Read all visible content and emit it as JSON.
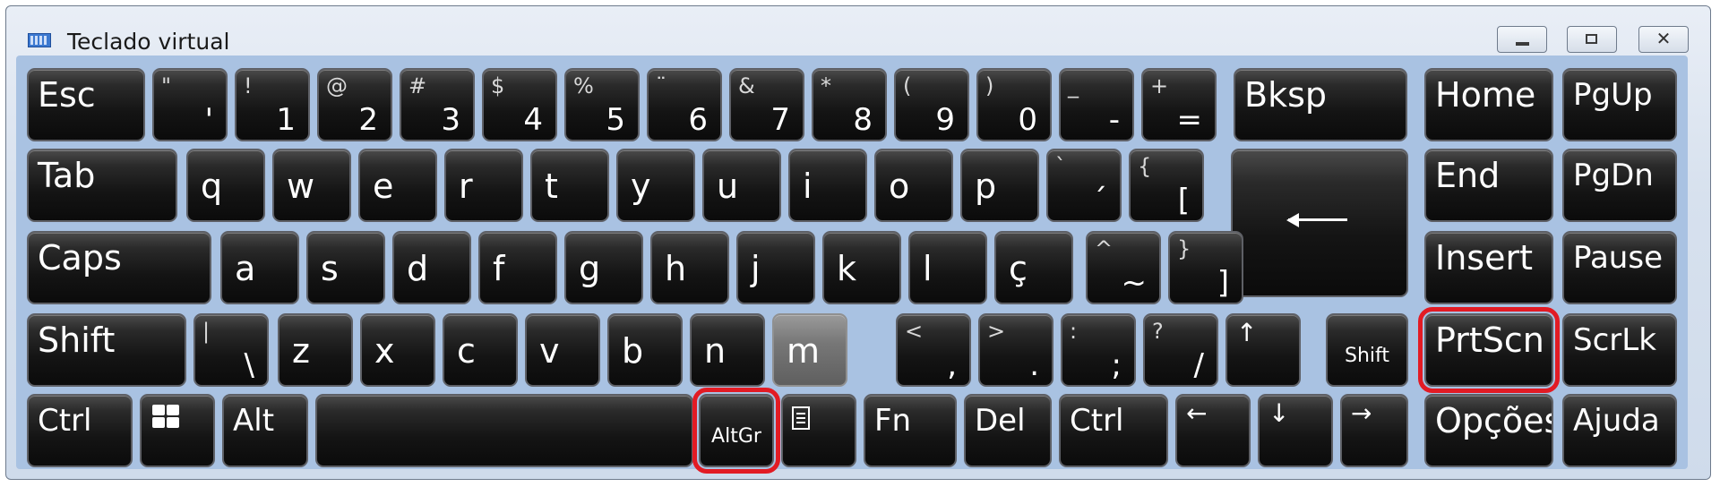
{
  "window": {
    "title": "Teclado virtual"
  },
  "titlebar_buttons": {
    "minimize": "",
    "maximize": "",
    "close": "✕"
  },
  "icons": {
    "app": "keyboard-icon",
    "windows": "windows-logo-icon",
    "menu": "context-menu-icon",
    "enter": "enter-arrow-icon"
  },
  "highlight_color": "#e21b24",
  "keys": {
    "esc": "Esc",
    "bksp": "Bksp",
    "home": "Home",
    "pgup": "PgUp",
    "tab": "Tab",
    "end": "End",
    "pgdn": "PgDn",
    "caps": "Caps",
    "insert": "Insert",
    "pause": "Pause",
    "shift_left": "Shift",
    "shift_right": "Shift",
    "prtscn": "PrtScn",
    "scrlk": "ScrLk",
    "ctrl_left": "Ctrl",
    "alt": "Alt",
    "altgr": "AltGr",
    "fn": "Fn",
    "del": "Del",
    "ctrl_right": "Ctrl",
    "opcoes": "Opções",
    "ajuda": "Ajuda",
    "arrow_up": "↑",
    "arrow_left": "←",
    "arrow_down": "↓",
    "arrow_right": "→",
    "row1": [
      {
        "s": "\"",
        "m": "'"
      },
      {
        "s": "!",
        "m": "1"
      },
      {
        "s": "@",
        "m": "2"
      },
      {
        "s": "#",
        "m": "3"
      },
      {
        "s": "$",
        "m": "4"
      },
      {
        "s": "%",
        "m": "5"
      },
      {
        "s": "¨",
        "m": "6"
      },
      {
        "s": "&",
        "m": "7"
      },
      {
        "s": "*",
        "m": "8"
      },
      {
        "s": "(",
        "m": "9"
      },
      {
        "s": ")",
        "m": "0"
      },
      {
        "s": "_",
        "m": "-"
      },
      {
        "s": "+",
        "m": "="
      }
    ],
    "row2": [
      "q",
      "w",
      "e",
      "r",
      "t",
      "y",
      "u",
      "i",
      "o",
      "p"
    ],
    "row2_sym": [
      {
        "s": "`",
        "m": "´"
      },
      {
        "s": "{",
        "m": "["
      }
    ],
    "row3": [
      "a",
      "s",
      "d",
      "f",
      "g",
      "h",
      "j",
      "k",
      "l",
      "ç"
    ],
    "row3_sym": [
      {
        "s": "^",
        "m": "~"
      },
      {
        "s": "}",
        "m": "]"
      }
    ],
    "row4_sym_first": {
      "s": "|",
      "m": "\\"
    },
    "row4": [
      "z",
      "x",
      "c",
      "v",
      "b",
      "n",
      "m"
    ],
    "row4_sym": [
      {
        "s": "<",
        "m": ","
      },
      {
        "s": ">",
        "m": "."
      },
      {
        "s": ":",
        "m": ";"
      },
      {
        "s": "?",
        "m": "/"
      }
    ]
  }
}
